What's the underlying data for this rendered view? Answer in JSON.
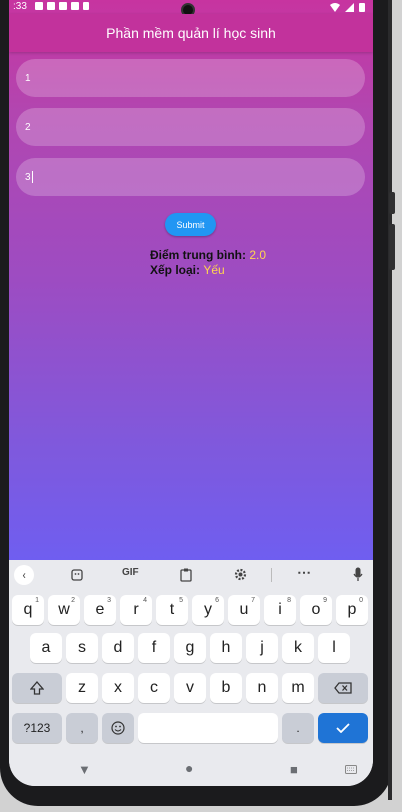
{
  "status": {
    "time": ":33"
  },
  "app": {
    "title": "Phần mềm quản lí học sinh",
    "fields": [
      {
        "value": "1"
      },
      {
        "value": "2"
      },
      {
        "value": "3"
      }
    ],
    "submit_label": "Submit",
    "average_label": "Điểm trung bình:",
    "average_value": "2.0",
    "rank_label": "Xếp loại:",
    "rank_value": "Yếu"
  },
  "keyboard": {
    "toolbar": {
      "gif_label": "GIF"
    },
    "row1": [
      {
        "k": "q",
        "n": "1"
      },
      {
        "k": "w",
        "n": "2"
      },
      {
        "k": "e",
        "n": "3"
      },
      {
        "k": "r",
        "n": "4"
      },
      {
        "k": "t",
        "n": "5"
      },
      {
        "k": "y",
        "n": "6"
      },
      {
        "k": "u",
        "n": "7"
      },
      {
        "k": "i",
        "n": "8"
      },
      {
        "k": "o",
        "n": "9"
      },
      {
        "k": "p",
        "n": "0"
      }
    ],
    "row2": [
      "a",
      "s",
      "d",
      "f",
      "g",
      "h",
      "j",
      "k",
      "l"
    ],
    "row3": [
      "z",
      "x",
      "c",
      "v",
      "b",
      "n",
      "m"
    ],
    "symbols_label": "?123",
    "comma_label": ",",
    "period_label": "."
  },
  "colors": {
    "accent": "#2196f3",
    "appbar": "#c2329c",
    "value": "#ffd54f",
    "enter": "#1f74d6"
  }
}
